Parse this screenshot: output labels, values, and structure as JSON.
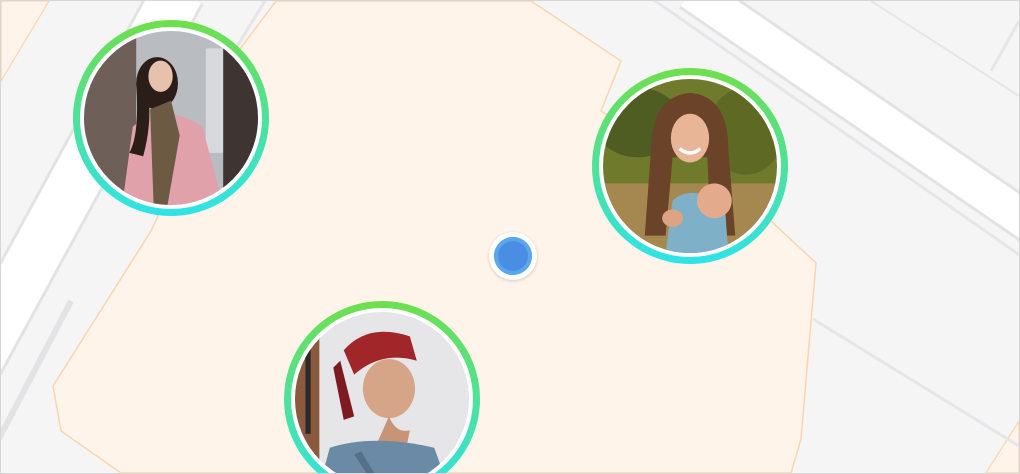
{
  "map": {
    "colors": {
      "background": "#f5f5f6",
      "road": "#ffffff",
      "road_edge": "#e3e3e5",
      "area_fill": "#fef4ea",
      "area_border": "#fbd5ad",
      "user_location": "#4a8ee3",
      "ring_start": "#6ee04b",
      "ring_end": "#2ee3e9"
    },
    "current_location": {
      "icon": "location-dot-icon"
    },
    "nearby_users": [
      {
        "id": "user-1",
        "photo": "woman-pink-coat-scarf"
      },
      {
        "id": "user-2",
        "photo": "woman-smiling-outdoors"
      },
      {
        "id": "user-3",
        "photo": "man-red-cap"
      }
    ]
  }
}
